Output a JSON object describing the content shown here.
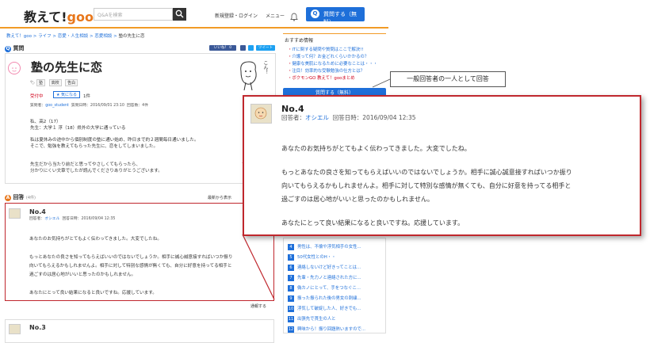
{
  "header": {
    "logo_text": "教えて!",
    "logo_goo": "goo",
    "search_placeholder": "Q&Aを検索",
    "signup_label": "新規登録・ログイン",
    "menu_label": "メニュー",
    "ask_button_icon": "Q",
    "ask_button_label": "質問する（無料）",
    "accent_color": "#f29b26",
    "brand_color": "#1e6fd9"
  },
  "breadcrumb": [
    "教えて！goo",
    "ライフ",
    "恋愛・人生相談",
    "恋愛相談",
    "塾の先生に恋"
  ],
  "question": {
    "section_icon": "Q",
    "section_label": "質問",
    "share_fb": "いいね！ 0",
    "share_tw": "ツイート",
    "title": "塾の先生に恋",
    "tags": [
      "塾",
      "高校",
      "告白"
    ],
    "status": "受付中",
    "kininaru_label": "気になる",
    "kininaru_count": "1件",
    "meta_prefix": "質問者：",
    "meta_user": "goo_student",
    "meta_date": "質問日時：2016/09/01 23:10",
    "meta_answers": "回答数：4件",
    "illust_text": "こん！",
    "body": [
      "私、高2（17）",
      "先生：大学１ 浮（18）県外の大学に通っている",
      "私は夏休みの途中から個別制度の塾に通い始め、昨日まで約２週間毎日通いました。",
      "そこで、勉強を教えてもらった先生に、恋をしてしまいました。",
      "先生だから当たり前だと思ってやさしくてもらったら、",
      "分かりにくい文章でしたが読んでくださりありがとうございます。"
    ]
  },
  "answers": {
    "section_icon": "A",
    "section_label": "回答",
    "count_label": "(4件)",
    "sort_label": "最新から表示",
    "report_label": "通報する",
    "a4": {
      "no": "No.4",
      "meta_prefix": "回答者：",
      "user": "オシエル",
      "date": "回答日時：2016/09/04 12:35",
      "lines": [
        "あなたのお気持ちがとてもよく伝わってきました。大変でしたね。",
        "もっとあなたの良さを知ってもらえばいいのではないでしょうか。相手に誠心誠意接すればいつか振り",
        "向いてもらえるかもしれませんよ。相手に対して特別な感情が無くても、自分に好意を持ってる相手と",
        "過ごすのは居心地がいいと思ったのかもしれません。",
        "あなたにとって良い結果になると良いですね。応援しています。"
      ]
    },
    "a3": {
      "no": "No.3"
    }
  },
  "sidebar": {
    "heading": "おすすめ情報",
    "links": [
      "ITに関する疑問や質問はここで解決!!",
      "介護って何？お金どれくらいかかるの？",
      "健康な美肌になるために必要なことは・・・",
      "注目！効率的な受験勉強の仕方とは？",
      "ボクモンGO 教えて！gooまとめ"
    ],
    "ask_button": "質問する（無料）",
    "ranking": [
      {
        "n": "4",
        "t": "男性は、不倫や浮気相手の女性..."
      },
      {
        "n": "5",
        "t": "50代女性とのH・・"
      },
      {
        "n": "6",
        "t": "連絡しないけど好きってことは..."
      },
      {
        "n": "7",
        "t": "先輩・先力ノと連絡された方に..."
      },
      {
        "n": "8",
        "t": "偽カノにとって、手をつなぐこ..."
      },
      {
        "n": "9",
        "t": "振った振られた後の男女の刺繍..."
      },
      {
        "n": "10",
        "t": "浮気して破綻した人、好きでも..."
      },
      {
        "n": "11",
        "t": "出張先で貫生の人と"
      },
      {
        "n": "12",
        "t": "興味から！振り回題熱いますので..."
      }
    ]
  },
  "annotation": {
    "note": "一般回答者の一人として回答",
    "highlight_color": "#c0272d"
  },
  "zoom": {
    "no": "No.4",
    "meta_prefix": "回答者：",
    "user": "オシエル",
    "date": "回答日時：2016/09/04 12:35",
    "lines": [
      "あなたのお気持ちがとてもよく伝わってきました。大変でしたね。",
      "もっとあなたの良さを知ってもらえばいいのではないでしょうか。相手に誠心誠意接すればいつか振り",
      "向いてもらえるかもしれませんよ。相手に対して特別な感情が無くても、自分に好意を持ってる相手と",
      "過ごすのは居心地がいいと思ったのかもしれません。",
      "あなたにとって良い結果になると良いですね。応援しています。"
    ]
  }
}
